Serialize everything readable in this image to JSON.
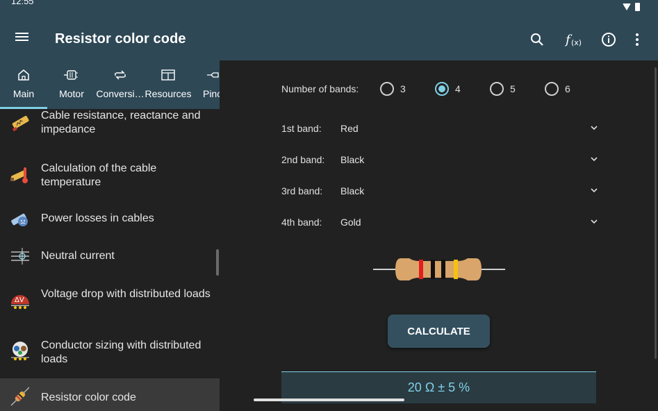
{
  "status": {
    "time": "12:55"
  },
  "appbar": {
    "title": "Resistor color code"
  },
  "tabs": [
    {
      "label": "Main",
      "icon": "home-icon"
    },
    {
      "label": "Motor",
      "icon": "motor-icon"
    },
    {
      "label": "Conversi…",
      "icon": "conversion-icon"
    },
    {
      "label": "Resources",
      "icon": "resources-icon"
    },
    {
      "label": "Pino",
      "icon": "pinout-icon"
    }
  ],
  "list": [
    {
      "label": "Cable resistance, reactance and impedance",
      "icon": "cable-impedance-icon"
    },
    {
      "label": "Calculation of the cable temperature",
      "icon": "cable-temperature-icon"
    },
    {
      "label": "Power losses in cables",
      "icon": "power-loss-icon"
    },
    {
      "label": "Neutral current",
      "icon": "neutral-current-icon"
    },
    {
      "label": "Voltage drop with distributed loads",
      "icon": "voltage-drop-icon"
    },
    {
      "label": "Conductor sizing with distributed loads",
      "icon": "conductor-sizing-icon"
    },
    {
      "label": "Resistor color code",
      "icon": "resistor-icon"
    }
  ],
  "form": {
    "bands_label": "Number of bands:",
    "band_options": [
      "3",
      "4",
      "5",
      "6"
    ],
    "selected_bands": "4",
    "bands": [
      {
        "label": "1st band:",
        "value": "Red"
      },
      {
        "label": "2nd band:",
        "value": "Black"
      },
      {
        "label": "3rd band:",
        "value": "Black"
      },
      {
        "label": "4th band:",
        "value": "Gold"
      }
    ],
    "calculate_label": "CALCULATE",
    "result": "20 Ω ± 5 %"
  },
  "colors": {
    "appbar": "#2e4856",
    "accent": "#7fd0e6",
    "background": "#212121",
    "band_colors": [
      "#e41e1e",
      "#111111",
      "#111111",
      "#f5c211"
    ]
  }
}
